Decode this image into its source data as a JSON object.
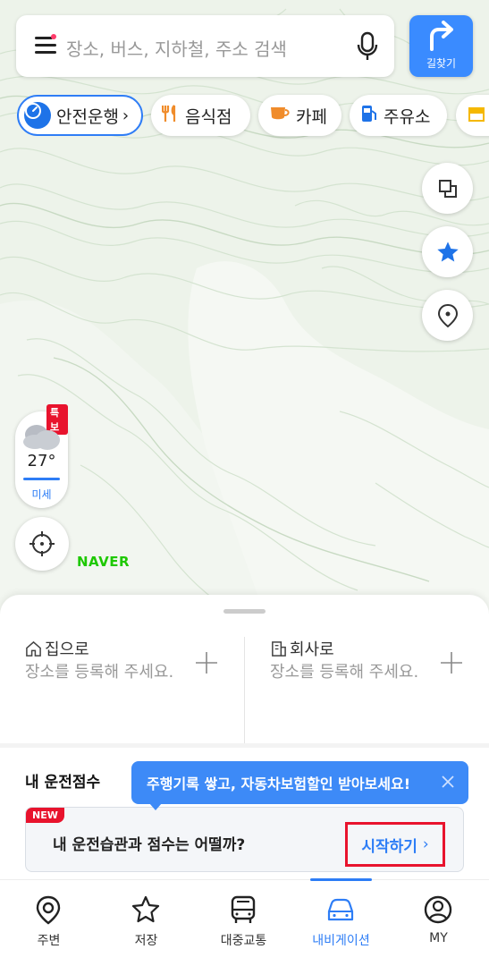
{
  "search": {
    "placeholder": "장소, 버스, 지하철, 주소 검색"
  },
  "route_button": {
    "label": "길찾기"
  },
  "chips": [
    {
      "label": "안전운행",
      "icon": "speedometer-icon"
    },
    {
      "label": "음식점",
      "icon": "fork-knife-icon"
    },
    {
      "label": "카페",
      "icon": "coffee-cup-icon"
    },
    {
      "label": "주유소",
      "icon": "gas-station-icon"
    }
  ],
  "weather": {
    "alert_badge": "특보",
    "temperature": "27°",
    "dust_label": "미세"
  },
  "map_logo": "NAVER",
  "favorites": {
    "home": {
      "title": "집으로",
      "desc": "장소를 등록해 주세요."
    },
    "work": {
      "title": "회사로",
      "desc": "장소를 등록해 주세요."
    }
  },
  "score": {
    "title": "내 운전점수",
    "tooltip": "주행기록 쌓고, 자동차보험할인 받아보세요!",
    "card_badge": "NEW",
    "card_text": "내 운전습관과 점수는 어떨까?",
    "start_label": "시작하기"
  },
  "tabs": [
    {
      "label": "주변",
      "icon": "location-pin-icon"
    },
    {
      "label": "저장",
      "icon": "star-icon"
    },
    {
      "label": "대중교통",
      "icon": "bus-icon"
    },
    {
      "label": "내비게이션",
      "icon": "car-icon",
      "active": true
    },
    {
      "label": "MY",
      "icon": "profile-icon"
    }
  ],
  "colors": {
    "accent": "#2d7df6",
    "route_button": "#3a8bff",
    "alert": "#e8132d",
    "naver_green": "#1ec800",
    "map_bg": "#edf3ea"
  }
}
